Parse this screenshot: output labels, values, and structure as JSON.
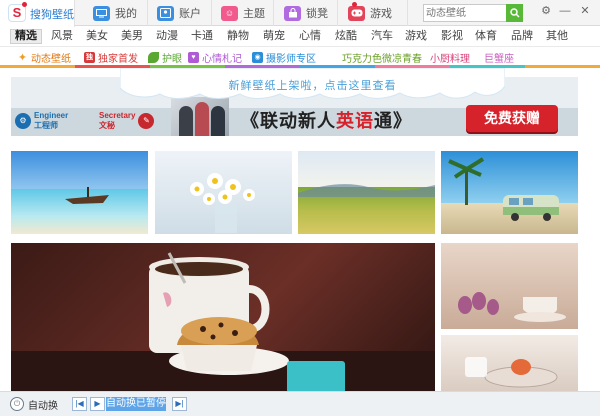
{
  "app": {
    "name": "搜狗壁纸"
  },
  "tabs": [
    {
      "label": "搜狗壁纸",
      "icon": "sogou-logo-icon",
      "active": true
    },
    {
      "label": "我的",
      "icon": "monitor-icon",
      "color": "#3b8fe0"
    },
    {
      "label": "账户",
      "icon": "account-icon",
      "color": "#3b8fe0"
    },
    {
      "label": "主题",
      "icon": "theme-icon",
      "color": "#f05a8c"
    },
    {
      "label": "锁凳",
      "icon": "lock-screen-icon",
      "color": "#b16be0"
    },
    {
      "label": "游戏",
      "icon": "game-icon",
      "color": "#e2455a"
    }
  ],
  "search": {
    "placeholder": "动态壁纸"
  },
  "categories": [
    "精选",
    "风景",
    "美女",
    "美男",
    "动漫",
    "卡通",
    "静物",
    "萌宠",
    "心情",
    "炫酷",
    "汽车",
    "游戏",
    "影视",
    "体育",
    "品牌",
    "其他"
  ],
  "subtopics": [
    {
      "label": "动态壁纸",
      "color": "#e07a14",
      "icon": "sparkle-icon"
    },
    {
      "label": "独家首发",
      "color": "#d63a3a",
      "icon": "exclusive-icon"
    },
    {
      "label": "护眼",
      "color": "#5aa832",
      "icon": "leaf-icon"
    },
    {
      "label": "心情札记",
      "color": "#b05ad6",
      "icon": "mood-note-icon"
    },
    {
      "label": "摄影师专区",
      "color": "#2a8ed8",
      "icon": "camera-icon"
    },
    {
      "label": "巧克力色微凉青春",
      "color": "#6aa028"
    },
    {
      "label": "小厨料理",
      "color": "#d6437a"
    },
    {
      "label": "巨蟹座",
      "color": "#c85fc0"
    }
  ],
  "notice": {
    "text": "新鲜壁纸上架啦，点击这里查看"
  },
  "banner": {
    "chip1_en": "Engineer",
    "chip1_cn": "工程师",
    "chip2_en": "Secretary",
    "chip2_cn": "文秘",
    "headline_pre": "《联动新人",
    "headline_hl": "英语",
    "headline_post": "通》",
    "cta": "免费获赠"
  },
  "bottom": {
    "auto_switch": "自动换",
    "status": "自动换已暂停"
  },
  "colors": {
    "accent": "#2a7ed2",
    "search_button": "#58b838",
    "banner_cta": "#d6232b"
  }
}
